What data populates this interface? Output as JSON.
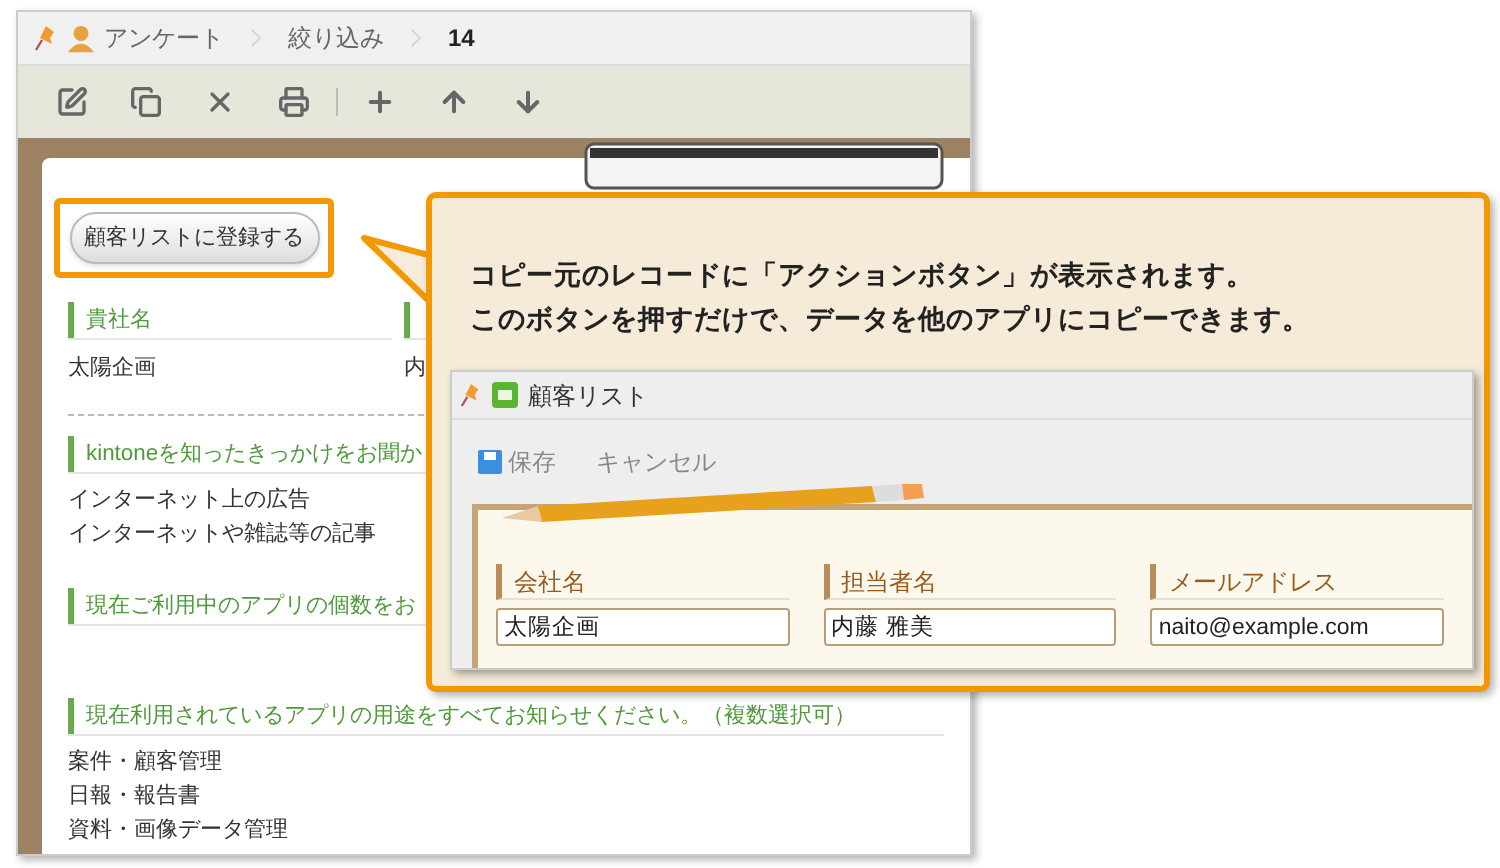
{
  "breadcrumb": [
    {
      "label": "アンケート"
    },
    {
      "label": "絞り込み"
    },
    {
      "label": "14"
    }
  ],
  "action_button": {
    "label": "顧客リストに登録する"
  },
  "record": {
    "columns_row": [
      {
        "label": "貴社名",
        "value": "太陽企画"
      },
      {
        "value": "内"
      }
    ],
    "sections": [
      {
        "label": "kintoneを知ったきっかけをお聞か",
        "values": [
          "インターネット上の広告",
          "インターネットや雑誌等の記事"
        ]
      },
      {
        "label": "現在ご利用中のアプリの個数をお"
      },
      {
        "label": "現在利用されているアプリの用途をすべてお知らせください。（複数選択可）",
        "values": [
          "案件・顧客管理",
          "日報・報告書",
          "資料・画像データ管理"
        ]
      }
    ]
  },
  "callout": {
    "lines": [
      "コピー元のレコードに「アクションボタン」が表示されます。",
      "このボタンを押すだけで、データを他のアプリにコピーできます。"
    ],
    "preview": {
      "title": "顧客リスト",
      "save": "保存",
      "cancel": "キャンセル",
      "fields": [
        {
          "label": "会社名",
          "value": "太陽企画"
        },
        {
          "label": "担当者名",
          "value": "内藤 雅美"
        },
        {
          "label": "メールアドレス",
          "value": "naito@example.com"
        }
      ]
    }
  }
}
